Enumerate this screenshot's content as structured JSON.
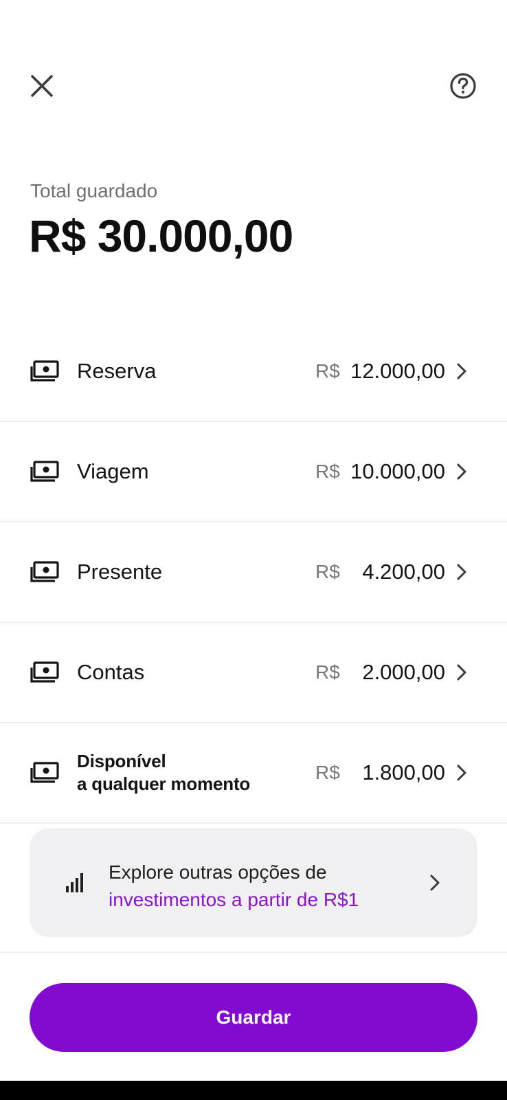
{
  "header": {
    "close_icon": "close-icon",
    "help_icon": "help-circle-icon"
  },
  "summary": {
    "label": "Total guardado",
    "value": "R$ 30.000,00"
  },
  "boxes": [
    {
      "name": "Reserva",
      "currency": "R$",
      "amount": "12.000,00",
      "icon": "money-box-icon"
    },
    {
      "name": "Viagem",
      "currency": "R$",
      "amount": "10.000,00",
      "icon": "money-box-icon"
    },
    {
      "name": "Presente",
      "currency": "R$",
      "amount": "4.200,00",
      "icon": "money-box-icon"
    },
    {
      "name": "Contas",
      "currency": "R$",
      "amount": "2.000,00",
      "icon": "money-box-icon"
    },
    {
      "name_line1": "Disponível",
      "name_line2": "a qualquer momento",
      "currency": "R$",
      "amount": "1.800,00",
      "icon": "money-box-icon"
    }
  ],
  "explore": {
    "line1": "Explore outras opções de",
    "line2": "investimentos a partir de R$1",
    "icon": "signal-bars-icon"
  },
  "actions": {
    "primary_label": "Guardar"
  },
  "colors": {
    "accent": "#820ad1",
    "card_bg": "#f0f0f3",
    "muted_text": "#76767c"
  }
}
